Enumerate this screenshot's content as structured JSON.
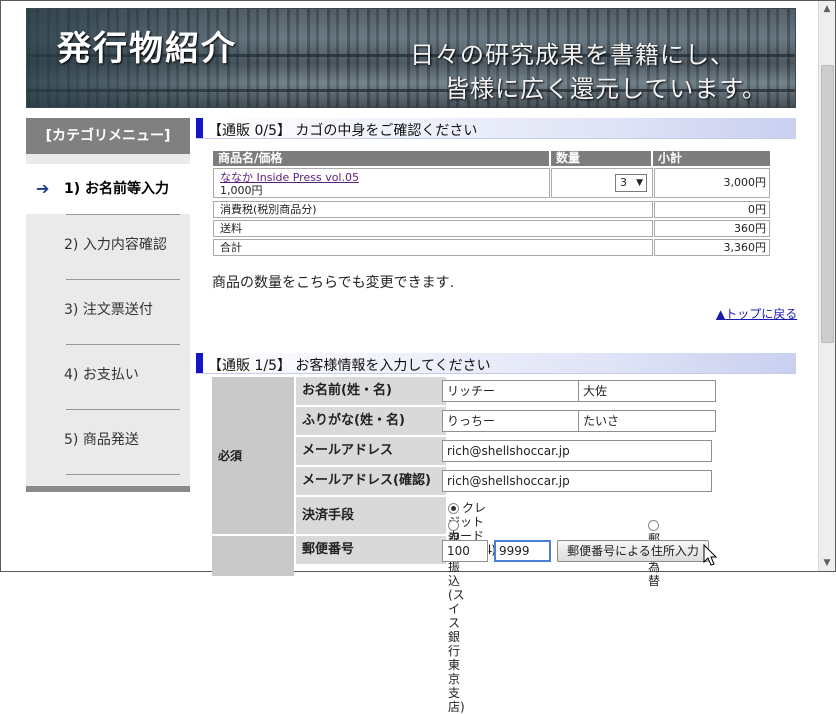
{
  "banner": {
    "title": "発行物紹介",
    "tagline_1": "日々の研究成果を書籍にし、",
    "tagline_2": "皆様に広く還元しています。"
  },
  "sidebar": {
    "heading": "[カテゴリメニュー]",
    "items": [
      {
        "label": "1) お名前等入力",
        "active": true
      },
      {
        "label": "2) 入力内容確認",
        "active": false
      },
      {
        "label": "3) 注文票送付",
        "active": false
      },
      {
        "label": "4) お支払い",
        "active": false
      },
      {
        "label": "5) 商品発送",
        "active": false
      }
    ]
  },
  "cart_section": {
    "heading": "【通販 0/5】 カゴの中身をご確認ください",
    "columns": [
      "商品名/価格",
      "数量",
      "小計"
    ],
    "item": {
      "link_text": "ななか Inside Press vol.05",
      "price": "1,000円",
      "quantity": "3",
      "subtotal": "3,000円"
    },
    "rows": [
      {
        "label": "消費税(税別商品分)",
        "value": "0円"
      },
      {
        "label": "送料",
        "value": "360円"
      },
      {
        "label": "合計",
        "value": "3,360円"
      }
    ],
    "note": "商品の数量をこちらでも変更できます.",
    "top_link": "▲トップに戻る"
  },
  "customer_section": {
    "heading": "【通販 1/5】 お客様情報を入力してください",
    "required_label": "必須",
    "fields": {
      "name_label": "お名前(姓・名)",
      "last_name": "リッチー",
      "first_name": "大佐",
      "kana_label": "ふりがな(姓・名)",
      "last_kana": "りっちー",
      "first_kana": "たいさ",
      "email_label": "メールアドレス",
      "email": "rich@shellshoccar.jp",
      "email_confirm_label": "メールアドレス(確認)",
      "email_confirm": "rich@shellshoccar.jp",
      "payment_label": "決済手段",
      "payment_options": [
        "クレジットカード(PayPal)",
        "銀行振込(スイス銀行東京支店)",
        "郵便為替"
      ],
      "payment_selected": "クレジットカード(PayPal)",
      "postal_label": "郵便番号",
      "postal_1": "100",
      "postal_separator": "-",
      "postal_2": "9999",
      "postal_button": "郵便番号による住所入力"
    }
  }
}
